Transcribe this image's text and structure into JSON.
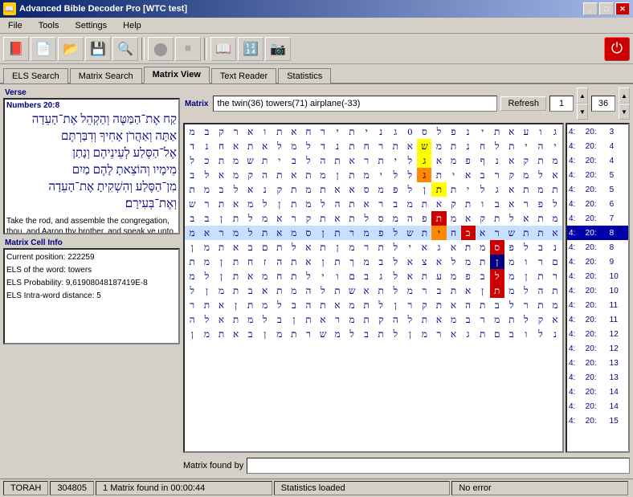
{
  "titleBar": {
    "title": "Advanced Bible Decoder Pro [WTC test]",
    "icon": "📖",
    "controls": [
      "_",
      "□",
      "✕"
    ]
  },
  "menu": {
    "items": [
      "File",
      "Tools",
      "Settings",
      "Help"
    ]
  },
  "toolbar": {
    "tools": [
      {
        "name": "book-icon",
        "symbol": "📕"
      },
      {
        "name": "document-icon",
        "symbol": "📄"
      },
      {
        "name": "open-icon",
        "symbol": "📂"
      },
      {
        "name": "save-icon",
        "symbol": "💾"
      },
      {
        "name": "search-icon",
        "symbol": "🔍"
      },
      {
        "name": "circle-icon",
        "symbol": "⬤"
      },
      {
        "name": "stop-icon",
        "symbol": "⏹"
      },
      {
        "name": "bible-icon",
        "symbol": "📖"
      },
      {
        "name": "calc-icon",
        "symbol": "🔢"
      },
      {
        "name": "camera-icon",
        "symbol": "📷"
      }
    ],
    "powerLabel": "⏻"
  },
  "tabs": [
    {
      "label": "ELS Search",
      "active": false
    },
    {
      "label": "Matrix Search",
      "active": false
    },
    {
      "label": "Matrix View",
      "active": true
    },
    {
      "label": "Text Reader",
      "active": false
    },
    {
      "label": "Statistics",
      "active": false
    }
  ],
  "leftPanel": {
    "verseLabel": "Verse",
    "verseRef": "Numbers 20:8",
    "verseHebrew": "קַח אֶת־הַמַּטֶּה וְהַקְהֵל אֶת־הָעֵדָה\nאַתָּה וְאַהֲרֹן אָחִיךָ וְדִבַּרְתֶּם\nאֶל־הַסֶּלַע לְעֵינֵיהֶם וְנָתַן\nמֵימָיו וְהוֹצֵאתָ לָהֶם מַיִם\nמִן־הַסֶּלַע וְהִשְׁקִיתָ אֶת־הָעֵדָה\nוְאֶת־בְּעִירָם׃",
    "verseEnglish": "Take the rod, and assemble the congregation, thou, and Aaron thy brother, and speak ye unto the rock before their eyes, that it give forth its water; and thou shalt bring forth to them water out of the rock; so thou shalt give the congregation and their cattle drink.'",
    "cellInfoLabel": "Matrix Cell Info",
    "cellInfo": {
      "position": "Current position:  222259",
      "elsWord": "ELS of the word: towers",
      "elsProbability": "ELS Probability: 9,61908048187419E-8",
      "elsDistance": "ELS Intra-word distance:  5"
    }
  },
  "rightPanel": {
    "matrixLabel": "Matrix",
    "searchText": "the twin(36) towers(71) airplane(-33)",
    "refreshLabel": "Refresh",
    "spinValue1": "1",
    "spinValue2": "36",
    "matrixFoundLabel": "Matrix found by",
    "matrixFoundValue": "",
    "grid": {
      "rows": [
        [
          "ג",
          "ו",
          "ע",
          "א",
          "ת",
          "י",
          "נ",
          "פ",
          "ל",
          "ס",
          "0",
          "ג",
          "נ",
          "י",
          "ת",
          "י",
          "ר",
          "ח",
          "א",
          "ת",
          "ו",
          "א",
          "ר",
          "ק",
          "ב",
          "מ"
        ],
        [
          "י",
          "ה",
          "י",
          "ת",
          "ל",
          "ח",
          "נ",
          "ת",
          "מ",
          "ש",
          "א",
          "ת",
          "ר",
          "ח",
          "ת",
          "נ",
          "ד",
          "ל",
          "מ",
          "ל",
          "א",
          "ת",
          "א",
          "ח",
          "נ",
          "ד"
        ],
        [
          "מ",
          "ת",
          "ק",
          "א",
          "נ",
          "ף",
          "פ",
          "מ",
          "א",
          "ג",
          "ל",
          "י",
          "ת",
          "ר",
          "א",
          "ת",
          "ה",
          "ל",
          "ב",
          "י",
          "ת",
          "ש",
          "מ",
          "ת",
          "כ",
          "ל"
        ],
        [
          "א",
          "ל",
          "מ",
          "ק",
          "ר",
          "ב",
          "א",
          "י",
          "ת",
          "ג",
          "ל",
          "ל",
          "י",
          "מ",
          "ת",
          "ן",
          "מ",
          "ת",
          "א",
          "ת",
          "ה",
          "ק",
          "מ",
          "א",
          "ל",
          "ב"
        ],
        [
          "ת",
          "מ",
          "ת",
          "א",
          "ג",
          "ל",
          "י",
          "ת",
          "ת",
          "ן",
          "ל",
          "פ",
          "מ",
          "ס",
          "א",
          "א",
          "ת",
          "מ",
          "ת",
          "ק",
          "נ",
          "א",
          "ל",
          "ב",
          "מ",
          "ת"
        ],
        [
          "ל",
          "פ",
          "ר",
          "א",
          "ב",
          "ו",
          "ת",
          "ק",
          "א",
          "ת",
          "מ",
          "ב",
          "ר",
          "א",
          "ת",
          "ה",
          "ל",
          "מ",
          "ת",
          "ן",
          "ל",
          "מ",
          "א",
          "ת",
          "ר",
          "ש"
        ],
        [
          "מ",
          "ת",
          "א",
          "ל",
          "ת",
          "ק",
          "א",
          "מ",
          "ת",
          "פ",
          "ה",
          "מ",
          "ס",
          "ל",
          "ת",
          "א",
          "ת",
          "ק",
          "ר",
          "א",
          "מ",
          "ל",
          "ת",
          "ן",
          "ב",
          "ב"
        ],
        [
          "א",
          "ת",
          "ת",
          "ש",
          "ר",
          "א",
          "ב",
          "ח",
          "י",
          "ת",
          "ש",
          "ל",
          "פ",
          "מ",
          "ר",
          "ת",
          "ן",
          "ס",
          "מ",
          "א",
          "ת",
          "ל",
          "מ",
          "ר",
          "א",
          "מ"
        ],
        [
          "נ",
          "ב",
          "ל",
          "פ",
          "ס",
          "מ",
          "ת",
          "א",
          "ג",
          "א",
          "י",
          "ל",
          "ת",
          "ר",
          "מ",
          "ן",
          "ת",
          "א",
          "ל",
          "ת",
          "ם",
          "ב",
          "א",
          "ת",
          "מ",
          "ן"
        ],
        [
          "ם",
          "ר",
          "ו",
          "מ",
          "ן",
          "ת",
          "מ",
          "ל",
          "א",
          "צ",
          "א",
          "ל",
          "ב",
          "מ",
          "ך",
          "ת",
          "ן",
          "א",
          "ת",
          "ה",
          "ז",
          "ח",
          "ת",
          "ן",
          "מ",
          "ת"
        ],
        [
          "ר",
          "ת",
          "ן",
          "מ",
          "ל",
          "ב",
          "פ",
          "מ",
          "ע",
          "ת",
          "א",
          "ל",
          "ג",
          "ב",
          "ם",
          "ו",
          "י",
          "ל",
          "ת",
          "ח",
          "מ",
          "א",
          "ת",
          "ן",
          "ל",
          "מ"
        ],
        [
          "ת",
          "ה",
          "ל",
          "מ",
          "ת",
          "ן",
          "א",
          "ת",
          "ב",
          "ר",
          "מ",
          "ל",
          "ת",
          "א",
          "ש",
          "ת",
          "ל",
          "ה",
          "מ",
          "ת",
          "א",
          "ב",
          "ת",
          "מ",
          "ן",
          "ל"
        ],
        [
          "מ",
          "ת",
          "ר",
          "ל",
          "ב",
          "ת",
          "ה",
          "א",
          "ת",
          "ק",
          "ר",
          "ן",
          "ל",
          "ת",
          "מ",
          "א",
          "ת",
          "ה",
          "ב",
          "ל",
          "מ",
          "ת",
          "ן",
          "א",
          "ת",
          "ר"
        ],
        [
          "א",
          "ק",
          "ל",
          "ת",
          "מ",
          "ר",
          "ב",
          "מ",
          "א",
          "ת",
          "ל",
          "ה",
          "ק",
          "ת",
          "מ",
          "ר",
          "א",
          "ת",
          "ן",
          "ב",
          "ל",
          "מ",
          "ת",
          "א",
          "ל",
          "ה"
        ],
        [
          "נ",
          "ל",
          "ו",
          "ב",
          "ם",
          "ת",
          "ג",
          "א",
          "ר",
          "מ",
          "ן",
          "ל",
          "ת",
          "ב",
          "ל",
          "מ",
          "ש",
          "ר",
          "ת",
          "מ",
          "ן",
          "ב",
          "א",
          "ת",
          "מ",
          "ן"
        ]
      ],
      "highlightedRow": 7,
      "specialCells": [
        {
          "row": 1,
          "col": 9,
          "class": "cell-yellow"
        },
        {
          "row": 2,
          "col": 9,
          "class": "cell-yellow"
        },
        {
          "row": 3,
          "col": 9,
          "class": "cell-orange"
        },
        {
          "row": 4,
          "col": 8,
          "class": "cell-yellow"
        },
        {
          "row": 6,
          "col": 8,
          "class": "cell-red"
        },
        {
          "row": 7,
          "col": 6,
          "class": "cell-red"
        },
        {
          "row": 7,
          "col": 8,
          "class": "cell-orange"
        },
        {
          "row": 8,
          "col": 4,
          "class": "cell-red"
        },
        {
          "row": 9,
          "col": 4,
          "class": "cell-blue-dark"
        },
        {
          "row": 10,
          "col": 4,
          "class": "cell-red"
        },
        {
          "row": 11,
          "col": 4,
          "class": "cell-red"
        }
      ]
    },
    "rowNumbers": [
      {
        "col1": "4:",
        "col2": "20:",
        "col3": "3"
      },
      {
        "col1": "4:",
        "col2": "20:",
        "col3": "4"
      },
      {
        "col1": "4:",
        "col2": "20:",
        "col3": "4"
      },
      {
        "col1": "4:",
        "col2": "20:",
        "col3": "5"
      },
      {
        "col1": "4:",
        "col2": "20:",
        "col3": "5"
      },
      {
        "col1": "4:",
        "col2": "20:",
        "col3": "6"
      },
      {
        "col1": "4:",
        "col2": "20:",
        "col3": "7"
      },
      {
        "col1": "4:",
        "col2": "20:",
        "col3": "8"
      },
      {
        "col1": "4:",
        "col2": "20:",
        "col3": "8"
      },
      {
        "col1": "4:",
        "col2": "20:",
        "col3": "9"
      },
      {
        "col1": "4:",
        "col2": "20:",
        "col3": "10"
      },
      {
        "col1": "4:",
        "col2": "20:",
        "col3": "10"
      },
      {
        "col1": "4:",
        "col2": "20:",
        "col3": "11"
      },
      {
        "col1": "4:",
        "col2": "20:",
        "col3": "11"
      },
      {
        "col1": "4:",
        "col2": "20:",
        "col3": "12"
      },
      {
        "col1": "4:",
        "col2": "20:",
        "col3": "12"
      },
      {
        "col1": "4:",
        "col2": "20:",
        "col3": "13"
      },
      {
        "col1": "4:",
        "col2": "20:",
        "col3": "13"
      },
      {
        "col1": "4:",
        "col2": "20:",
        "col3": "14"
      },
      {
        "col1": "4:",
        "col2": "20:",
        "col3": "14"
      },
      {
        "col1": "4:",
        "col2": "20:",
        "col3": "15"
      }
    ]
  },
  "statusBar": {
    "torah": "TORAH",
    "position": "304805",
    "matrixFound": "1 Matrix found in 00:00:44",
    "statsLoaded": "Statistics loaded",
    "error": "No error"
  }
}
